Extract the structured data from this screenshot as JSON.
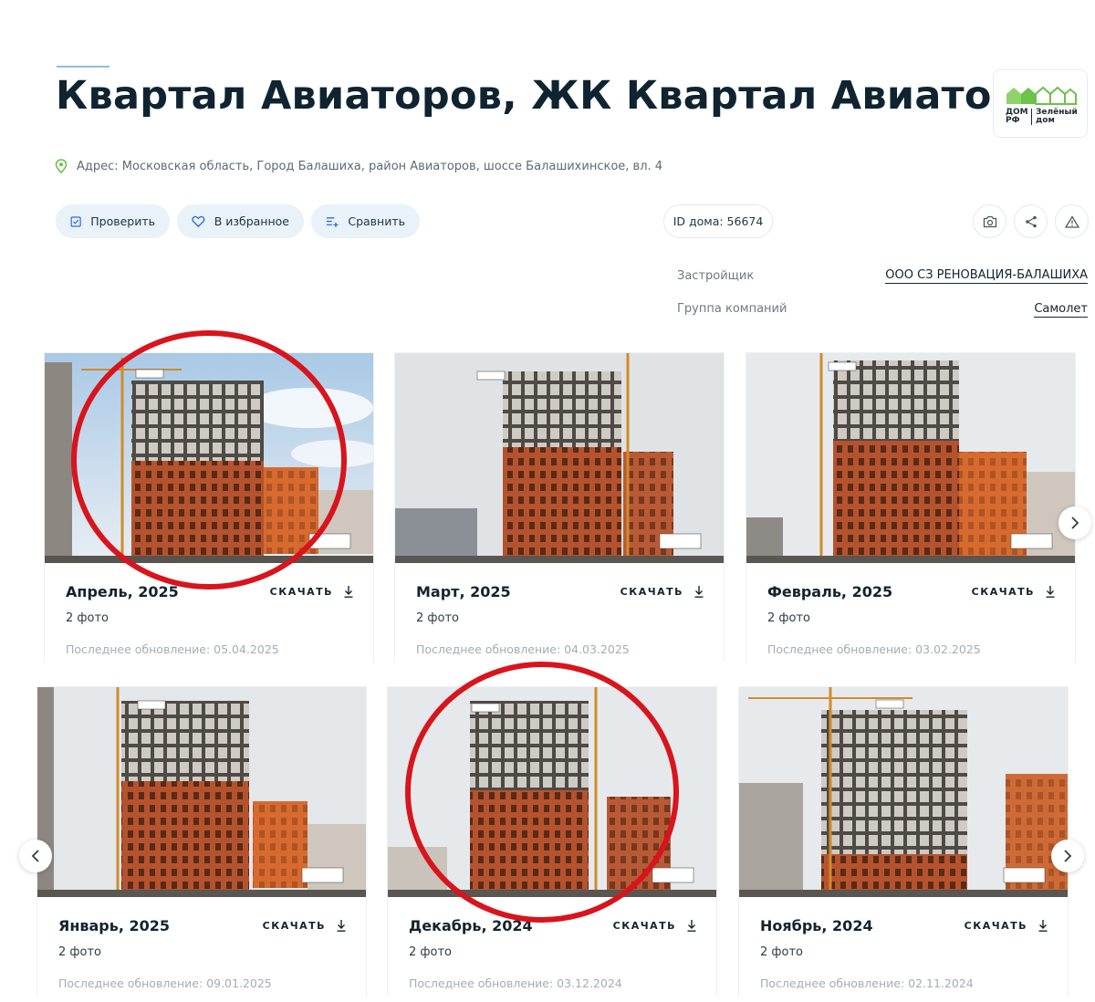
{
  "header": {
    "title": "Квартал Авиаторов, ЖК Квартал Авиаторов",
    "address": "Адрес: Московская область, Город Балашиха, район Авиаторов, шоссе Балашихинское, вл. 4"
  },
  "logo": {
    "brand_line1": "Зелёный",
    "brand_line2": "дом",
    "mark_line1": "ДОМ",
    "mark_line2": "РФ",
    "brand_color": "#6cc24a"
  },
  "actions": {
    "check_label": "Проверить",
    "favorite_label": "В избранное",
    "compare_label": "Сравнить",
    "house_id": "ID дома: 56674"
  },
  "info": {
    "developer_label": "Застройщик",
    "developer_value": "ООО СЗ РЕНОВАЦИЯ-БАЛАШИХА",
    "group_label": "Группа компаний",
    "group_value": "Самолет"
  },
  "cards": [
    {
      "month": "Апрель, 2025",
      "download_label": "СКАЧАТЬ",
      "count": "2 фото",
      "updated": "Последнее обновление: 05.04.2025"
    },
    {
      "month": "Март, 2025",
      "download_label": "СКАЧАТЬ",
      "count": "2 фото",
      "updated": "Последнее обновление: 04.03.2025"
    },
    {
      "month": "Февраль, 2025",
      "download_label": "СКАЧАТЬ",
      "count": "2 фото",
      "updated": "Последнее обновление: 03.02.2025"
    },
    {
      "month": "Январь, 2025",
      "download_label": "СКАЧАТЬ",
      "count": "2 фото",
      "updated": "Последнее обновление: 09.01.2025"
    },
    {
      "month": "Декабрь, 2024",
      "download_label": "СКАЧАТЬ",
      "count": "2 фото",
      "updated": "Последнее обновление: 03.12.2024"
    },
    {
      "month": "Ноябрь, 2024",
      "download_label": "СКАЧАТЬ",
      "count": "2 фото",
      "updated": "Последнее обновление: 02.11.2024"
    }
  ],
  "colors": {
    "button_bg": "#e9f1f9",
    "icon_blue": "#2a6fd6",
    "annotation_red": "#d8141c",
    "brick": "#b5532e"
  }
}
